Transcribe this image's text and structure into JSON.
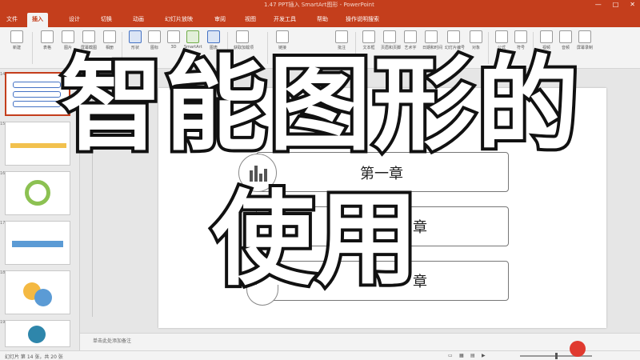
{
  "window": {
    "title": "1.47 PPT插入 SmartArt图形 - PowerPoint"
  },
  "tabs": [
    "文件",
    "插入",
    "设计",
    "切换",
    "动画",
    "幻灯片放映",
    "审阅",
    "视图",
    "开发工具",
    "帮助",
    "操作说明搜索"
  ],
  "active_tab_index": 1,
  "ribbon": {
    "items": [
      {
        "label": "新建",
        "icon": "new-slide-icon"
      },
      {
        "label": "表格",
        "icon": "table-icon"
      },
      {
        "label": "图片",
        "icon": "picture-icon"
      },
      {
        "label": "屏幕截图",
        "icon": "screenshot-icon"
      },
      {
        "label": "相册",
        "icon": "album-icon"
      },
      {
        "label": "形状",
        "icon": "shapes-icon"
      },
      {
        "label": "图标",
        "icon": "icons-icon"
      },
      {
        "label": "3D",
        "icon": "3d-model-icon"
      },
      {
        "label": "SmartArt",
        "icon": "smartart-icon"
      },
      {
        "label": "图表",
        "icon": "chart-icon"
      },
      {
        "label": "获取加载项",
        "icon": "addins-icon"
      },
      {
        "label": "链接",
        "icon": "link-icon"
      },
      {
        "label": "批注",
        "icon": "comment-icon"
      },
      {
        "label": "文本框",
        "icon": "textbox-icon"
      },
      {
        "label": "页眉和页脚",
        "icon": "header-footer-icon"
      },
      {
        "label": "艺术字",
        "icon": "wordart-icon"
      },
      {
        "label": "日期和时间",
        "icon": "datetime-icon"
      },
      {
        "label": "幻灯片编号",
        "icon": "slide-number-icon"
      },
      {
        "label": "对象",
        "icon": "object-icon"
      },
      {
        "label": "公式",
        "icon": "equation-icon"
      },
      {
        "label": "符号",
        "icon": "symbol-icon"
      },
      {
        "label": "视频",
        "icon": "video-icon"
      },
      {
        "label": "音频",
        "icon": "audio-icon"
      },
      {
        "label": "屏幕录制",
        "icon": "screen-record-icon"
      }
    ]
  },
  "thumbnails": [
    {
      "num": "14"
    },
    {
      "num": "15"
    },
    {
      "num": "16"
    },
    {
      "num": "17"
    },
    {
      "num": "18"
    },
    {
      "num": "19"
    }
  ],
  "slide": {
    "chapters": [
      "第一章",
      "章",
      "章"
    ]
  },
  "notes": {
    "placeholder": "单击此处添加备注"
  },
  "status": {
    "left": "幻灯片 第 14 张，共 20 张"
  },
  "overlay": {
    "line1": "智能图形的",
    "line2": "使用"
  },
  "colors": {
    "accent": "#c43e1c"
  }
}
